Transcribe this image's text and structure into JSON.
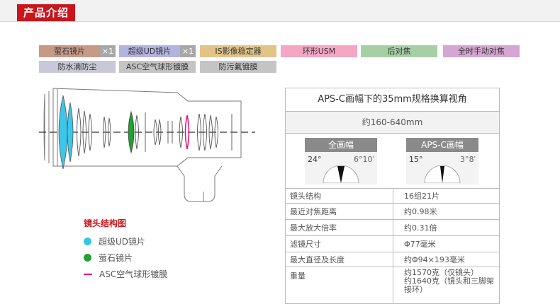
{
  "header": {
    "title": "产品介绍"
  },
  "tags": {
    "fluorite": {
      "label": "萤石镜片",
      "badge": "×1"
    },
    "super_ud": {
      "label": "超级UD镜片",
      "badge": "×1"
    },
    "is": {
      "label": "IS影像稳定器"
    },
    "usm": {
      "label": "环形USM"
    },
    "rear_focus": {
      "label": "后对焦"
    },
    "full_time_mf": {
      "label": "全时手动对焦"
    },
    "weather": {
      "label": "防水滴防尘"
    },
    "asc": {
      "label": "ASC空气球形镀膜"
    },
    "fluorine": {
      "label": "防污氟镀膜"
    }
  },
  "legend": {
    "title": "镜头结构图",
    "items": [
      {
        "label": "超级UD镜片"
      },
      {
        "label": "萤石镜片"
      },
      {
        "label": "ASC空气球形镀膜"
      }
    ]
  },
  "panel": {
    "title": "APS-C画幅下的35mm规格换算视角",
    "range": "约160-640mm",
    "full_frame": {
      "label": "全画幅",
      "wide": "24°",
      "tele": "6°10′"
    },
    "aps_c": {
      "label": "APS-C画幅",
      "wide": "15°",
      "tele": "3°8′"
    },
    "specs": [
      {
        "key": "镜头结构",
        "value": "16组21片"
      },
      {
        "key": "最近对焦距离",
        "value": "约0.98米"
      },
      {
        "key": "最大放大倍率",
        "value": "约0.31倍"
      },
      {
        "key": "滤镜尺寸",
        "value": "Φ77毫米"
      },
      {
        "key": "最大直径及长度",
        "value": "约Φ94×193毫米"
      },
      {
        "key": "重量",
        "value": "约1570克（仅镜头）\n约1640克（镜头和三脚架接环）"
      }
    ]
  },
  "colors": {
    "brand_red": "#c8161d",
    "super_ud": "#33c6e8",
    "fluorite": "#22a031",
    "asc": "#e0197d"
  }
}
